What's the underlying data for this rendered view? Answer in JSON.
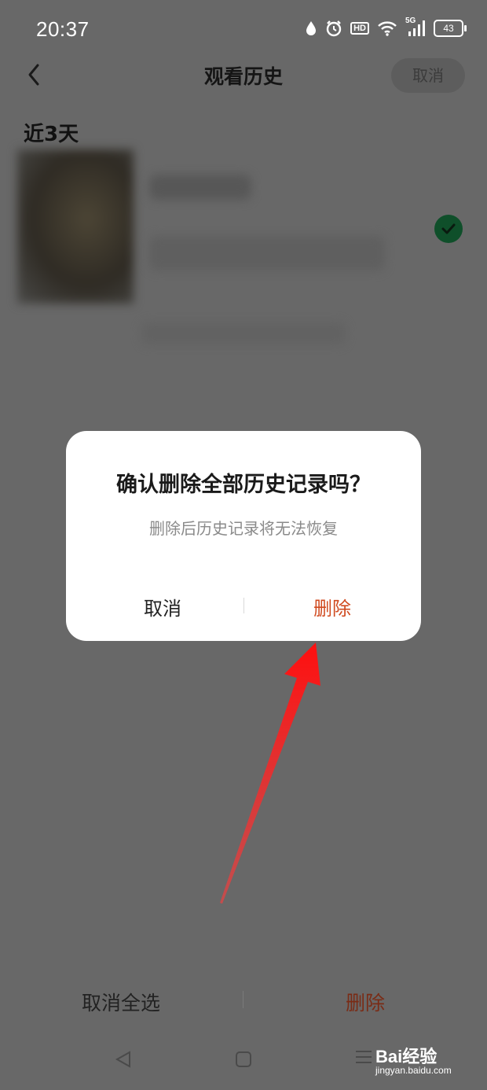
{
  "status_bar": {
    "time": "20:37",
    "network": "5G",
    "hd": "HD",
    "battery": "43",
    "icons": [
      "water-drop-icon",
      "alarm-icon",
      "hd-icon",
      "wifi-icon",
      "signal-icon",
      "battery-icon"
    ]
  },
  "nav": {
    "title": "观看历史",
    "cancel_label": "取消"
  },
  "section": {
    "label": "近3天"
  },
  "item": {
    "selected": true
  },
  "dialog": {
    "title": "确认删除全部历史记录吗？",
    "message": "删除后历史记录将无法恢复",
    "cancel_label": "取消",
    "delete_label": "删除"
  },
  "bottom_bar": {
    "cancel_all_label": "取消全选",
    "delete_label": "删除"
  },
  "watermark": {
    "brand": "Bai经验",
    "url": "jingyan.baidu.com"
  },
  "colors": {
    "overlay": "#686868",
    "dialog_bg": "#ffffff",
    "danger": "#d04a1f",
    "check": "#0f4f2a",
    "arrow": "#ff1a1a"
  }
}
